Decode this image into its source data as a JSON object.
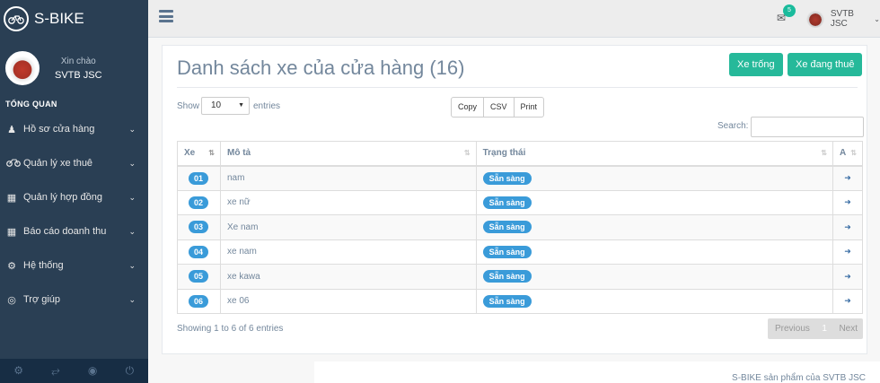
{
  "brand": {
    "name": "S-BIKE",
    "logo_icon": "bicycle-icon"
  },
  "profile": {
    "greeting": "Xin chào",
    "name": "SVTB JSC"
  },
  "sidebar": {
    "section_title": "TỔNG QUAN",
    "items": [
      {
        "label": "Hồ sơ cửa hàng",
        "icon": "user-icon"
      },
      {
        "label": "Quản lý xe thuê",
        "icon": "bicycle-icon"
      },
      {
        "label": "Quản lý hợp đồng",
        "icon": "qrcode-icon"
      },
      {
        "label": "Báo cáo doanh thu",
        "icon": "qrcode-icon"
      },
      {
        "label": "Hệ thống",
        "icon": "gear-icon"
      },
      {
        "label": "Trợ giúp",
        "icon": "lifebuoy-icon"
      }
    ],
    "footer_icons": [
      "settings-icon",
      "fullscreen-icon",
      "eye-slash-icon",
      "power-icon"
    ]
  },
  "topbar": {
    "notification_count": "5",
    "user_name": "SVTB JSC"
  },
  "main": {
    "title": "Danh sách xe của cửa hàng (16)",
    "buttons": {
      "free": "Xe trống",
      "rented": "Xe đang thuê"
    },
    "show_label": "Show",
    "page_size": "10",
    "entries_label": "entries",
    "export": {
      "copy": "Copy",
      "csv": "CSV",
      "print": "Print"
    },
    "search_label": "Search:",
    "table": {
      "columns": [
        "Xe",
        "Mô tả",
        "Trạng thái",
        "A"
      ],
      "rows": [
        {
          "id": "01",
          "desc": "nam",
          "status": "Sẵn sàng"
        },
        {
          "id": "02",
          "desc": "xe nữ",
          "status": "Sẵn sàng"
        },
        {
          "id": "03",
          "desc": "Xe nam",
          "status": "Sẵn sàng"
        },
        {
          "id": "04",
          "desc": "xe nam",
          "status": "Sẵn sàng"
        },
        {
          "id": "05",
          "desc": "xe kawa",
          "status": "Sẵn sàng"
        },
        {
          "id": "06",
          "desc": "xe 06",
          "status": "Sẵn sàng"
        }
      ]
    },
    "showing": "Showing 1 to 6 of 6 entries",
    "pagination": {
      "previous": "Previous",
      "current": "1",
      "next": "Next"
    }
  },
  "footer": {
    "text": "S-BIKE sản phẩm của SVTB JSC"
  },
  "colors": {
    "sidebar": "#2a3f54",
    "accent_green": "#26b99a",
    "badge_blue": "#3a9bd9"
  }
}
